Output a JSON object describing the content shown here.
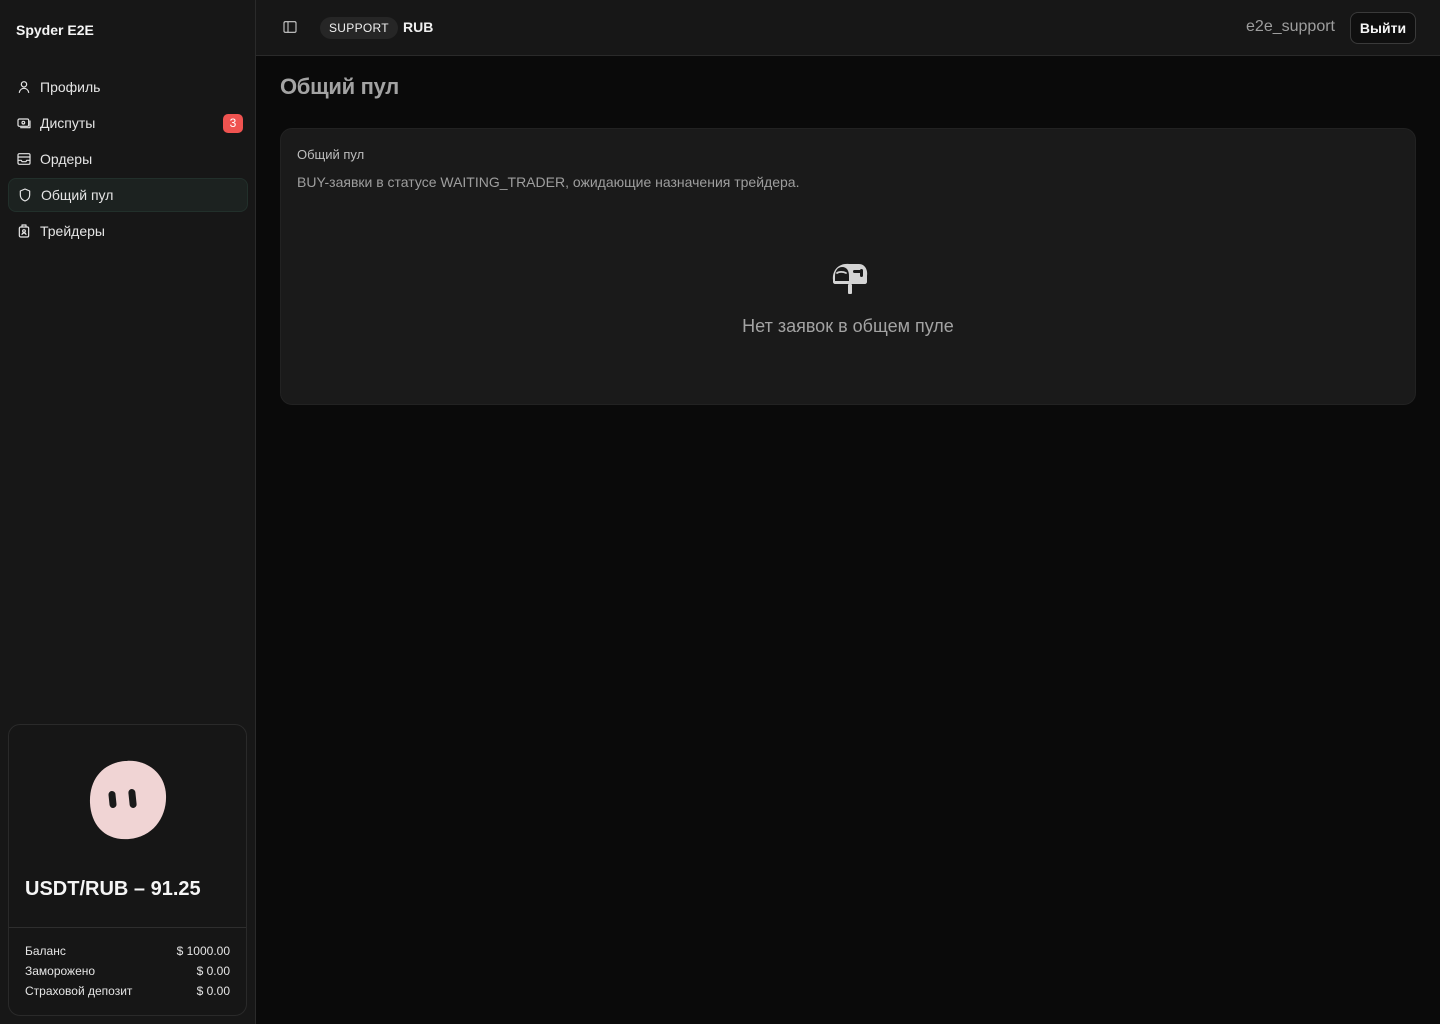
{
  "app": {
    "brand": "Spyder E2E"
  },
  "sidebar": {
    "items": [
      {
        "label": "Профиль",
        "icon": "user-icon",
        "active": false
      },
      {
        "label": "Диспуты",
        "icon": "disputes-icon",
        "badge": "3",
        "active": false
      },
      {
        "label": "Ордеры",
        "icon": "inbox-icon",
        "active": false
      },
      {
        "label": "Общий пул",
        "icon": "shield-icon",
        "active": true
      },
      {
        "label": "Трейдеры",
        "icon": "traders-icon",
        "active": false
      }
    ],
    "rate_card": {
      "title": "USDT/RUB – 91.25",
      "rows": [
        {
          "label": "Баланс",
          "value": "$ 1000.00"
        },
        {
          "label": "Заморожено",
          "value": "$ 0.00"
        },
        {
          "label": "Страховой депозит",
          "value": "$ 0.00"
        }
      ]
    }
  },
  "header": {
    "role": "SUPPORT",
    "currency": "RUB",
    "username": "e2e_support",
    "logout_label": "Выйти"
  },
  "main": {
    "title": "Общий пул",
    "card": {
      "title": "Общий пул",
      "description": "BUY-заявки в статусе WAITING_TRADER, ожидающие назначения трейдера.",
      "empty_text": "Нет заявок в общем пуле"
    }
  },
  "colors": {
    "badge": "#ef5350",
    "mascot": "#f0d4d4",
    "sidebar_bg": "#171717",
    "page_bg": "#0a0a0a"
  }
}
